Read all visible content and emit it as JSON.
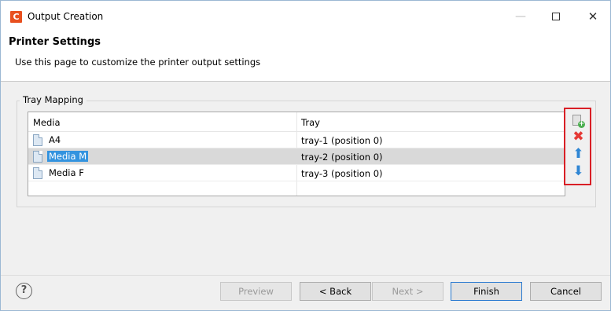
{
  "window": {
    "title": "Output Creation",
    "app_icon_letter": "C",
    "minimize_symbol": "—",
    "close_symbol": "✕"
  },
  "header": {
    "title": "Printer Settings",
    "description": "Use this page to customize the printer output settings"
  },
  "tray_mapping": {
    "group_label": "Tray Mapping",
    "columns": {
      "media": "Media",
      "tray": "Tray"
    },
    "rows": [
      {
        "media": "A4",
        "tray": "tray-1 (position 0)",
        "selected": false
      },
      {
        "media": "Media M",
        "tray": "tray-2 (position 0)",
        "selected": true
      },
      {
        "media": "Media F",
        "tray": "tray-3 (position 0)",
        "selected": false
      }
    ],
    "actions": {
      "add_icon": "add-document-icon",
      "delete_icon": "delete-x-icon",
      "delete_symbol": "✖",
      "up_icon": "arrow-up-icon",
      "up_symbol": "⬆",
      "down_icon": "arrow-down-icon",
      "down_symbol": "⬇",
      "highlight_color": "#d91f26"
    }
  },
  "footer": {
    "help_symbol": "?",
    "buttons": {
      "preview": "Preview",
      "back": "< Back",
      "next": "Next >",
      "finish": "Finish",
      "cancel": "Cancel"
    }
  }
}
